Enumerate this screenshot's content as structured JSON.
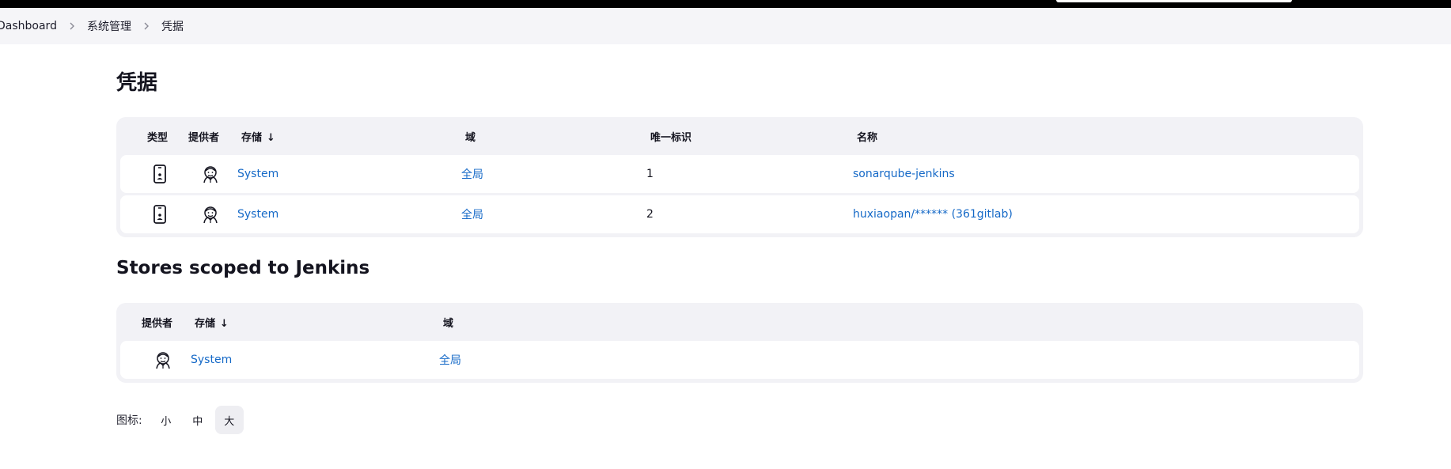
{
  "breadcrumb": [
    {
      "label": "Dashboard"
    },
    {
      "label": "系统管理"
    },
    {
      "label": "凭据"
    }
  ],
  "page_title": "凭据",
  "credentials_table": {
    "headers": {
      "type": "类型",
      "provider": "提供者",
      "store": "存储",
      "store_sort": "↓",
      "domain": "域",
      "id": "唯一标识",
      "name": "名称"
    },
    "rows": [
      {
        "store": "System",
        "domain": "全局",
        "id": "1",
        "name": "sonarqube-jenkins"
      },
      {
        "store": "System",
        "domain": "全局",
        "id": "2",
        "name": "huxiaopan/****** (361gitlab)"
      }
    ]
  },
  "stores_section_title": "Stores scoped to Jenkins",
  "stores_table": {
    "headers": {
      "provider": "提供者",
      "store": "存储",
      "store_sort": "↓",
      "domain": "域"
    },
    "rows": [
      {
        "store": "System",
        "domain": "全局"
      }
    ]
  },
  "icon_size": {
    "label": "图标:",
    "options": [
      "小",
      "中",
      "大"
    ],
    "selected": "大"
  },
  "colors": {
    "link": "#1569c7",
    "topbar": "#000000",
    "breadcrumb_bg": "#f5f5f8",
    "table_bg": "#f2f2f6"
  },
  "icons": {
    "type": "mobile-credential-icon",
    "provider": "jenkins-butler-icon",
    "separator": "chevron-right-icon"
  }
}
